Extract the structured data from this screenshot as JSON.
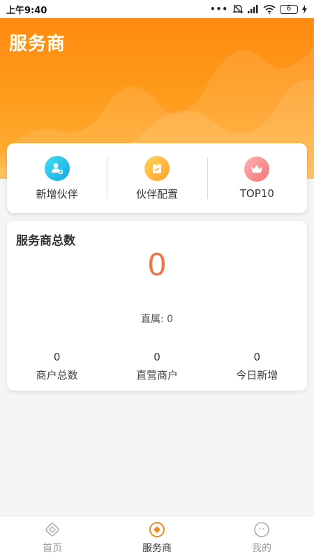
{
  "status_bar": {
    "time": "上午9:40",
    "battery": "6"
  },
  "header": {
    "title": "服务商",
    "color": "#ff8a10"
  },
  "quick_actions": [
    {
      "label": "新增伙伴",
      "icon": "add-user-icon",
      "color": "#16a7e8"
    },
    {
      "label": "伙伴配置",
      "icon": "clipboard-icon",
      "color": "#ff9f2a"
    },
    {
      "label": "TOP10",
      "icon": "crown-icon",
      "color": "#f37474"
    }
  ],
  "stats": {
    "title": "服务商总数",
    "total": "0",
    "direct_text": "直属: 0",
    "items": [
      {
        "value": "0",
        "label": "商户总数"
      },
      {
        "value": "0",
        "label": "直营商户"
      },
      {
        "value": "0",
        "label": "今日新增"
      }
    ]
  },
  "bottom_nav": {
    "items": [
      {
        "label": "首页",
        "icon": "home-icon"
      },
      {
        "label": "服务商",
        "icon": "service-provider-icon",
        "active": true
      },
      {
        "label": "我的",
        "icon": "profile-icon"
      }
    ],
    "active_color": "#f08a1c"
  }
}
